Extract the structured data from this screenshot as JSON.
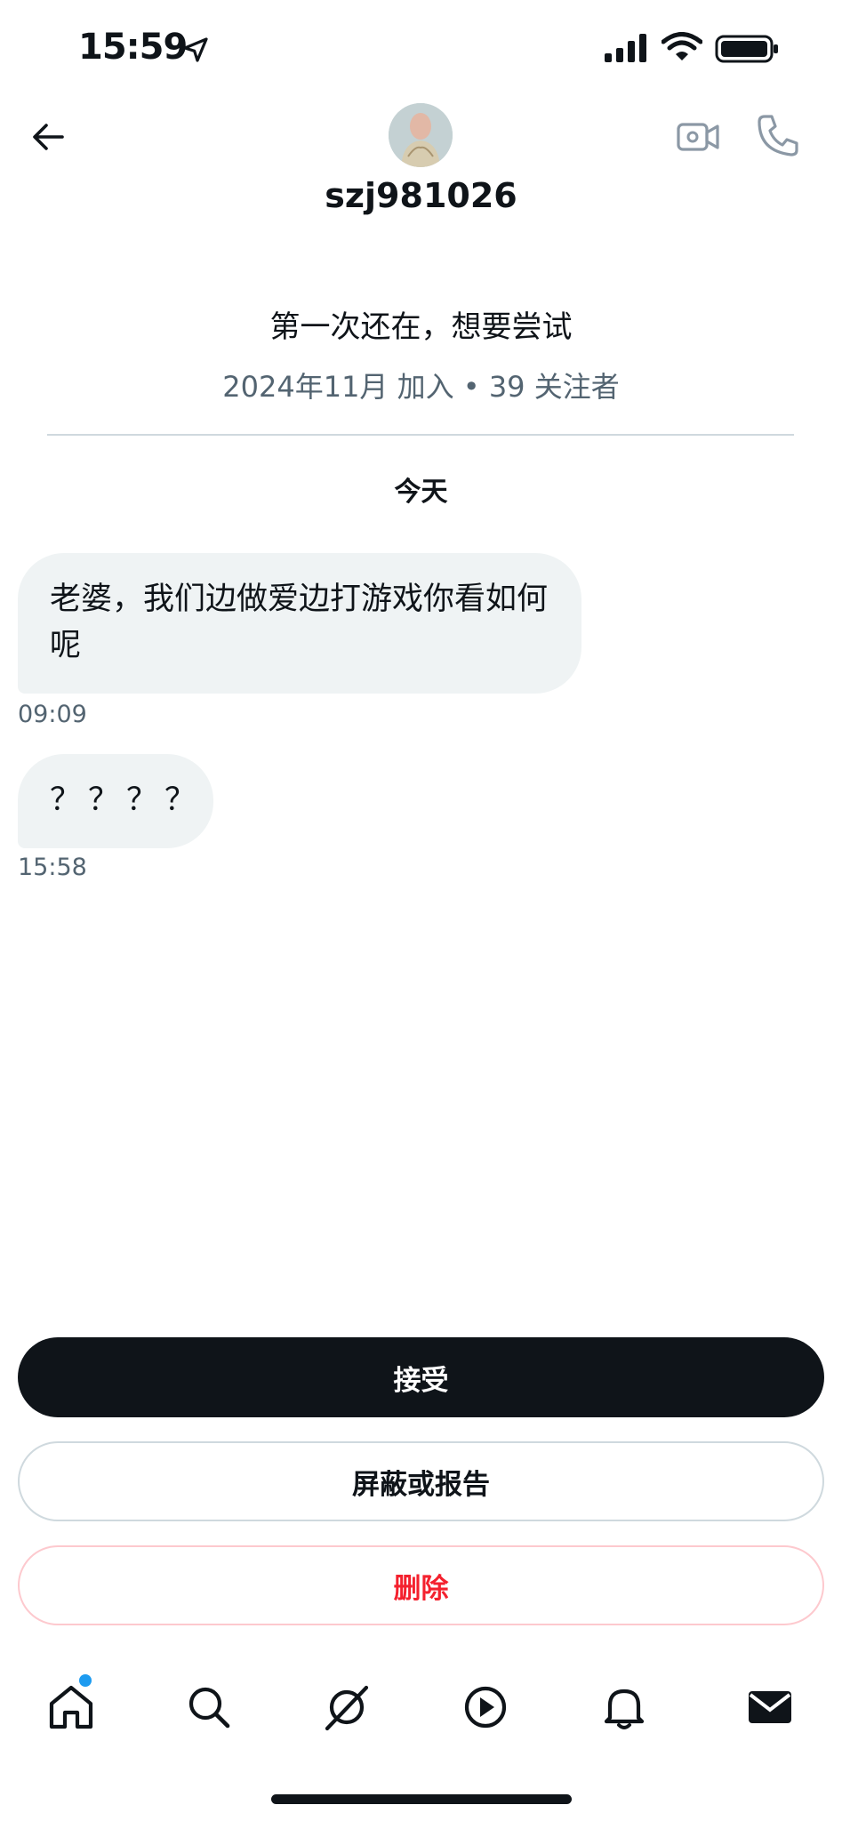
{
  "status_bar": {
    "time": "15:59"
  },
  "header": {
    "username": "szj981026"
  },
  "profile": {
    "bio": "第一次还在，想要尝试",
    "meta": "2024年11月 加入 • 39 关注者"
  },
  "conversation": {
    "date_separator": "今天",
    "messages": [
      {
        "text": "老婆，我们边做爱边打游戏你看如何呢",
        "time": "09:09"
      },
      {
        "text": "？？？？",
        "time": "15:58"
      }
    ]
  },
  "actions": {
    "accept_label": "接受",
    "block_report_label": "屏蔽或报告",
    "delete_label": "删除"
  },
  "colors": {
    "accent": "#1d9bf0",
    "danger": "#f4212e",
    "primary_button": "#0f1419",
    "bubble": "#eff3f4"
  },
  "nav": {
    "items": [
      "home-icon",
      "search-icon",
      "grok-icon",
      "video-icon",
      "notifications-icon",
      "messages-icon"
    ]
  }
}
